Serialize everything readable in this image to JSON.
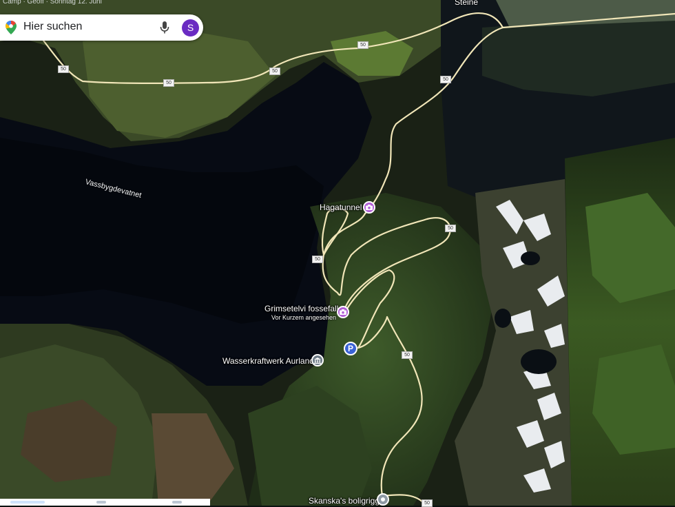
{
  "search": {
    "placeholder": "Hier suchen",
    "avatar_letter": "S"
  },
  "top_strip_text": "Camp · Geöff · Sonntag 12. Juni",
  "place_labels": {
    "town": "Steine",
    "lake": "Vassbygdevatnet"
  },
  "pois": {
    "hagatunnel": {
      "label": "Hagatunnel",
      "icon": "camera-icon"
    },
    "grimsetelvi": {
      "label": "Grimsetelvi fossefall",
      "sublabel": "Vor Kurzem angesehen",
      "icon": "camera-icon"
    },
    "parking": {
      "label": "P",
      "icon": "parking-icon"
    },
    "wasserkraftwerk": {
      "label": "Wasserkraftwerk Aurland",
      "icon": "government-building-icon"
    },
    "skanska": {
      "label": "Skanska's boligrigg",
      "icon": "place-icon"
    }
  },
  "road_shields": [
    "50",
    "50",
    "50",
    "50",
    "50",
    "50",
    "50",
    "50",
    "50"
  ],
  "colors": {
    "water": "#0a0f1a",
    "road": "#f1e6b8",
    "avatar": "#6a2bc2",
    "camera_pin": "#b25fd6",
    "parking_pin": "#3b63d6"
  }
}
